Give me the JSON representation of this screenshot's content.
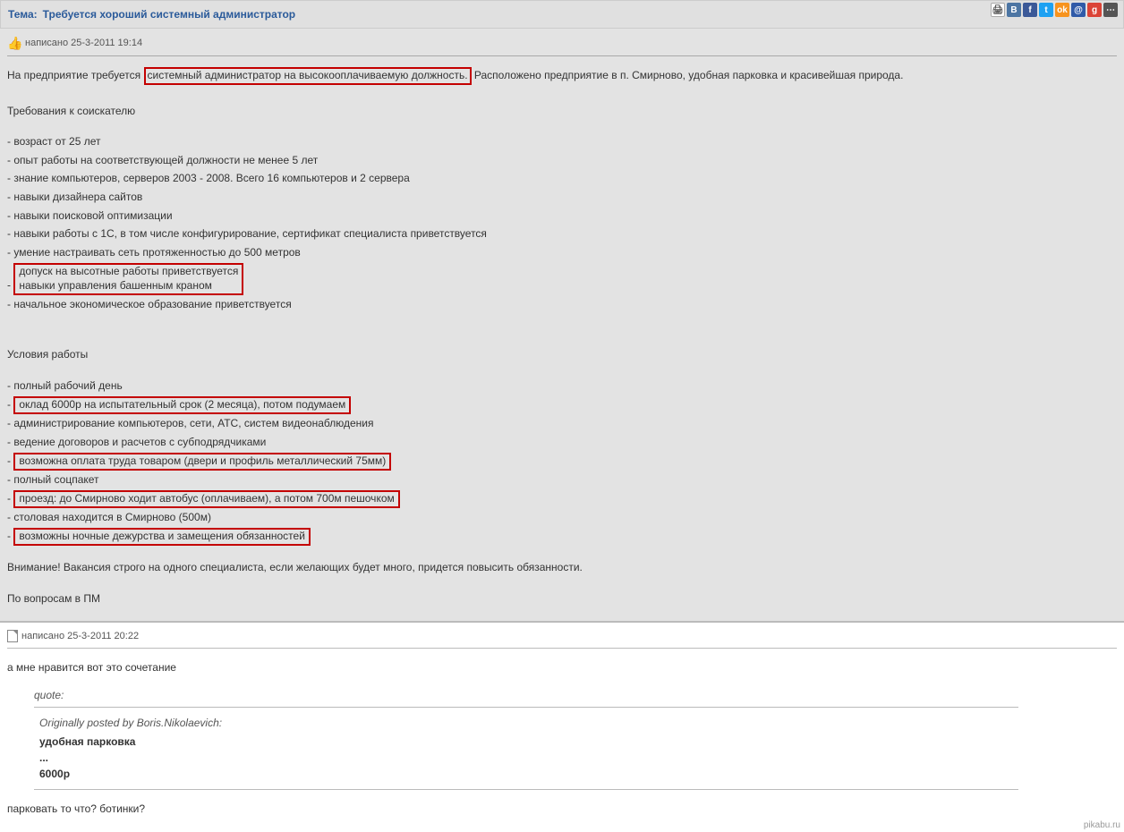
{
  "header": {
    "label": "Тема:",
    "title": "Требуется хороший системный администратор"
  },
  "social": [
    "print",
    "vk",
    "fb",
    "tw",
    "ok",
    "mr",
    "gp",
    "ext"
  ],
  "post": {
    "meta": "написано 25-3-2011 19:14",
    "intro_pre": "На предприятие требуется",
    "intro_hl": "системный администратор на высокооплачиваемую должность.",
    "intro_post": "Расположено предприятие в п. Смирново, удобная парковка и красивейшая природа.",
    "req_header": "Требования к соискателю",
    "req": [
      "- возраст от 25 лет",
      "- опыт работы на соответствующей должности не менее 5 лет",
      "- знание компьютеров, серверов 2003 - 2008. Всего 16 компьютеров и 2 сервера",
      "- навыки дизайнера сайтов",
      "- навыки поисковой оптимизации",
      "- навыки работы с 1С, в том числе конфигурирование, сертификат специалиста приветствуется",
      "- умение настраивать сеть протяженностью до 500 метров"
    ],
    "req_hl_block": "допуск на высотные работы приветствуется\nнавыки управления башенным краном",
    "req_after": "- начальное экономическое образование приветствуется",
    "cond_header": "Условия работы",
    "cond1": "- полный рабочий день",
    "cond_hl1": "оклад 6000р на испытательный срок (2 месяца), потом подумаем",
    "cond2": "- администрирование компьютеров, сети, АТС, систем видеонаблюдения",
    "cond3": "- ведение договоров и расчетов с субподрядчиками",
    "cond_hl2": "возможна оплата труда товаром (двери и профиль металлический 75мм)",
    "cond4": "- полный соцпакет",
    "cond_hl3": "проезд: до Смирново ходит автобус (оплачиваем), а потом 700м пешочком",
    "cond5": "- столовая находится в Смирново (500м)",
    "cond_hl4": "возможны ночные дежурства и замещения обязанностей",
    "attention": "Внимание! Вакансия строго на одного специалиста, если желающих будет много, придется повысить обязанности.",
    "footer": "По вопросам в ПМ"
  },
  "reply": {
    "meta": "написано 25-3-2011 20:22",
    "text1": "а мне нравится вот это сочетание",
    "quote_label": "quote:",
    "quote_head": "Originally posted by Boris.Nikolaevich:",
    "quote_line1": "удобная парковка",
    "quote_line2": "...",
    "quote_line3": "6000р",
    "text2": "парковать то что? ботинки?"
  },
  "watermark": "pikabu.ru"
}
